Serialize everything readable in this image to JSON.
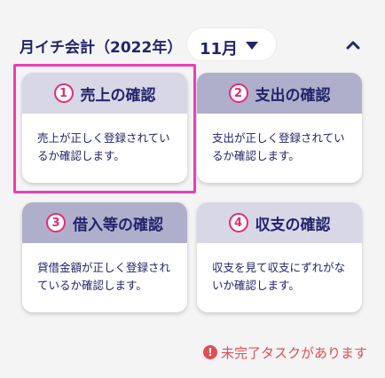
{
  "header": {
    "title": "月イチ会計（2022年）",
    "month": "11月",
    "month_caret_icon": "caret-down-icon",
    "collapse_icon": "chevron-up-icon"
  },
  "cards": [
    {
      "number": "1",
      "title": "売上の確認",
      "description": "売上が正しく登録されているか確認します。",
      "selected": true
    },
    {
      "number": "2",
      "title": "支出の確認",
      "description": "支出が正しく登録されているか確認します。",
      "selected": false
    },
    {
      "number": "3",
      "title": "借入等の確認",
      "description": "貸借金額が正しく登録されているか確認します。",
      "selected": false
    },
    {
      "number": "4",
      "title": "収支の確認",
      "description": "収支を見て収支にずれがないか確認します。",
      "selected": false
    }
  ],
  "warning": {
    "icon": "exclamation-icon",
    "glyph": "!",
    "text": "未完了タスクがあります"
  },
  "colors": {
    "navy": "#23246b",
    "accent_pink": "#e42c75",
    "highlight": "#ea3fb5",
    "warning_red": "#e34d53",
    "card_header_light": "#d7d7e6",
    "card_header_dark": "#afafcb"
  }
}
